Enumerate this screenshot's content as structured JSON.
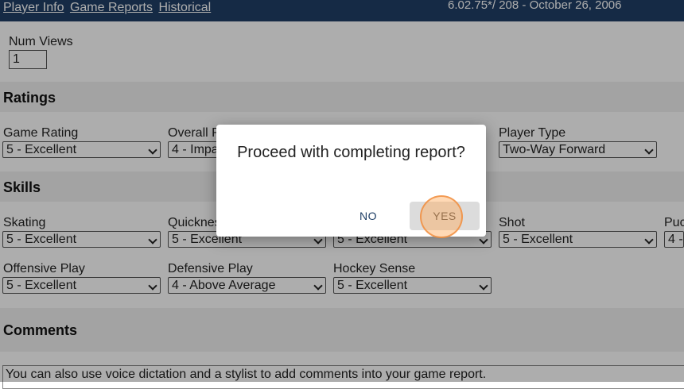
{
  "header": {
    "nav": [
      "Player Info",
      "Game Reports",
      "Historical"
    ],
    "version": "6.02.75*/ 208 - October 26, 2006"
  },
  "num_views": {
    "label": "Num Views",
    "value": "1"
  },
  "ratings": {
    "title": "Ratings",
    "fields": [
      {
        "label": "Game Rating",
        "value": "5 - Excellent"
      },
      {
        "label": "Overall R",
        "value": "4 - Impa"
      },
      {
        "label": "Player Type",
        "value": "Two-Way Forward"
      }
    ]
  },
  "skills": {
    "title": "Skills",
    "row1": [
      {
        "label": "Skating",
        "value": "5 - Excellent"
      },
      {
        "label": "Quicknes",
        "value": "5 - Excellent"
      },
      {
        "label": "",
        "value": "5 - Excellent"
      },
      {
        "label": "Shot",
        "value": "5 - Excellent"
      },
      {
        "label": "Puc",
        "value": "4 -"
      }
    ],
    "row2": [
      {
        "label": "Offensive Play",
        "value": "5 - Excellent"
      },
      {
        "label": "Defensive Play",
        "value": "4 - Above Average"
      },
      {
        "label": "Hockey Sense",
        "value": "5 - Excellent"
      }
    ]
  },
  "comments": {
    "title": "Comments",
    "text": "You can also use voice dictation and a stylist to add comments into your game report."
  },
  "dialog": {
    "message": "Proceed with completing report?",
    "no_label": "NO",
    "yes_label": "YES"
  }
}
